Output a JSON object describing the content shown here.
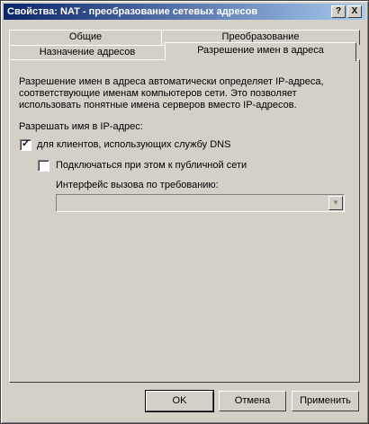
{
  "window": {
    "title": "Свойства: NAT - преобразование сетевых адресов",
    "help_glyph": "?",
    "close_glyph": "X"
  },
  "tabs": {
    "row_back": [
      {
        "label": "Общие"
      },
      {
        "label": "Преобразование"
      }
    ],
    "row_front": [
      {
        "label": "Назначение адресов"
      },
      {
        "label": "Разрешение имен в адреса"
      }
    ],
    "active": "Разрешение имен в адреса"
  },
  "panel": {
    "description": "Разрешение имен в адреса автоматически определяет IP-адреса, соответствующие именам компьютеров сети. Это позволяет использовать понятные имена серверов вместо IP-адресов.",
    "resolve_label": "Разрешать имя в IP-адрес:",
    "dns_clients": {
      "label": "для клиентов, использующих службу DNS",
      "checked": true
    },
    "connect_public": {
      "label": "Подключаться при этом к публичной сети",
      "checked": false
    },
    "demand_dial_label": "Интерфейс вызова по требованию:",
    "demand_dial_value": ""
  },
  "buttons": {
    "ok": "OK",
    "cancel": "Отмена",
    "apply": "Применить"
  }
}
